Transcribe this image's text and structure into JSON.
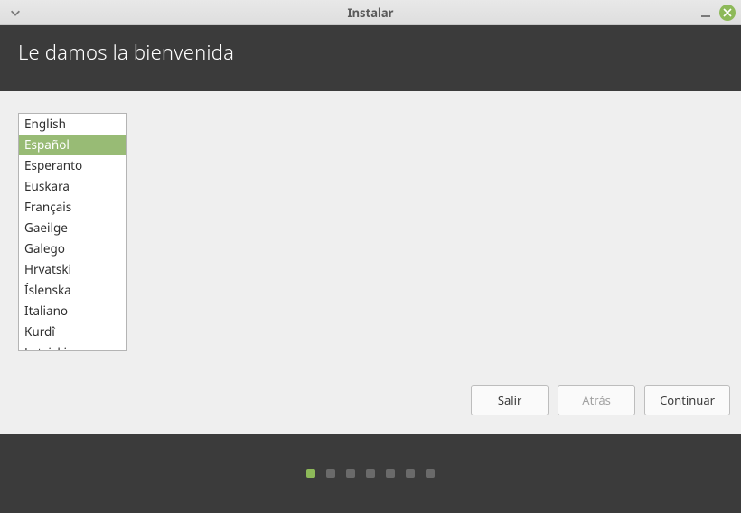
{
  "window": {
    "title": "Instalar"
  },
  "header": {
    "title": "Le damos la bienvenida"
  },
  "languages": {
    "items": [
      "English",
      "Español",
      "Esperanto",
      "Euskara",
      "Français",
      "Gaeilge",
      "Galego",
      "Hrvatski",
      "Íslenska",
      "Italiano",
      "Kurdî",
      "Latviski"
    ],
    "selected_index": 1
  },
  "buttons": {
    "quit": "Salir",
    "back": "Atrás",
    "continue": "Continuar"
  },
  "progress": {
    "total_steps": 7,
    "current_step": 0
  }
}
